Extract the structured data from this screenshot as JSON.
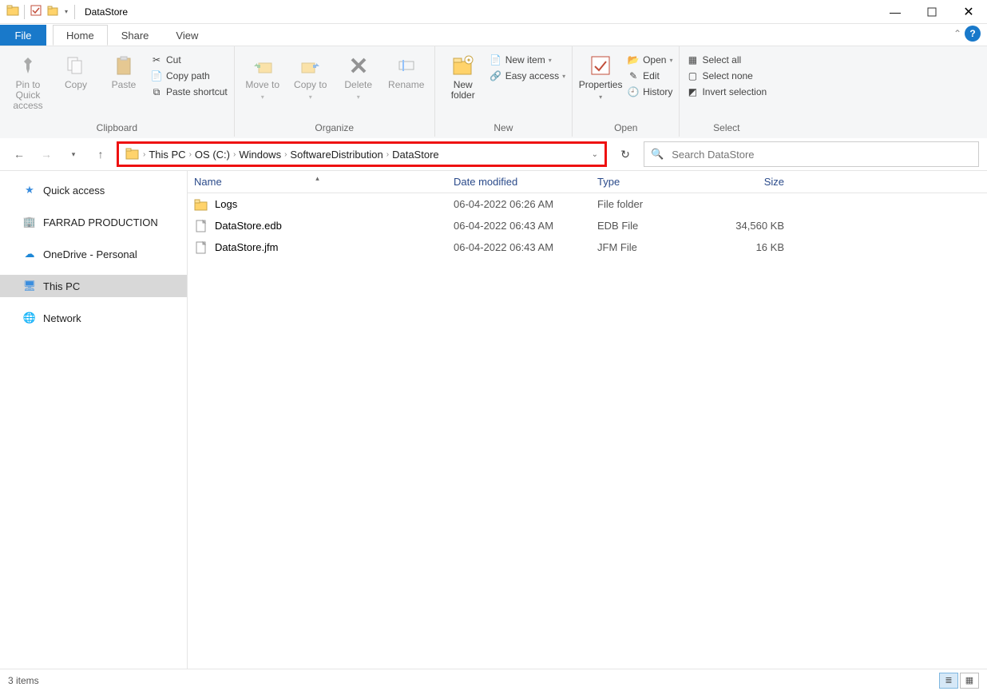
{
  "window": {
    "title": "DataStore"
  },
  "tabs": {
    "file": "File",
    "home": "Home",
    "share": "Share",
    "view": "View"
  },
  "ribbon": {
    "clipboard": {
      "label": "Clipboard",
      "pin": "Pin to Quick access",
      "copy": "Copy",
      "paste": "Paste",
      "cut": "Cut",
      "copypath": "Copy path",
      "shortcut": "Paste shortcut"
    },
    "organize": {
      "label": "Organize",
      "moveto": "Move to",
      "copyto": "Copy to",
      "delete": "Delete",
      "rename": "Rename"
    },
    "new": {
      "label": "New",
      "newfolder": "New folder",
      "newitem": "New item",
      "easyaccess": "Easy access"
    },
    "open": {
      "label": "Open",
      "properties": "Properties",
      "open": "Open",
      "edit": "Edit",
      "history": "History"
    },
    "select": {
      "label": "Select",
      "selectall": "Select all",
      "selectnone": "Select none",
      "invert": "Invert selection"
    }
  },
  "breadcrumb": {
    "parts": [
      "This PC",
      "OS (C:)",
      "Windows",
      "SoftwareDistribution",
      "DataStore"
    ]
  },
  "search": {
    "placeholder": "Search DataStore"
  },
  "tree": {
    "quick": "Quick access",
    "farrad": "FARRAD PRODUCTION",
    "onedrive": "OneDrive - Personal",
    "thispc": "This PC",
    "network": "Network"
  },
  "columns": {
    "name": "Name",
    "date": "Date modified",
    "type": "Type",
    "size": "Size"
  },
  "files": [
    {
      "icon": "folder",
      "name": "Logs",
      "date": "06-04-2022 06:26 AM",
      "type": "File folder",
      "size": ""
    },
    {
      "icon": "file",
      "name": "DataStore.edb",
      "date": "06-04-2022 06:43 AM",
      "type": "EDB File",
      "size": "34,560 KB"
    },
    {
      "icon": "file",
      "name": "DataStore.jfm",
      "date": "06-04-2022 06:43 AM",
      "type": "JFM File",
      "size": "16 KB"
    }
  ],
  "status": {
    "count": "3 items"
  }
}
